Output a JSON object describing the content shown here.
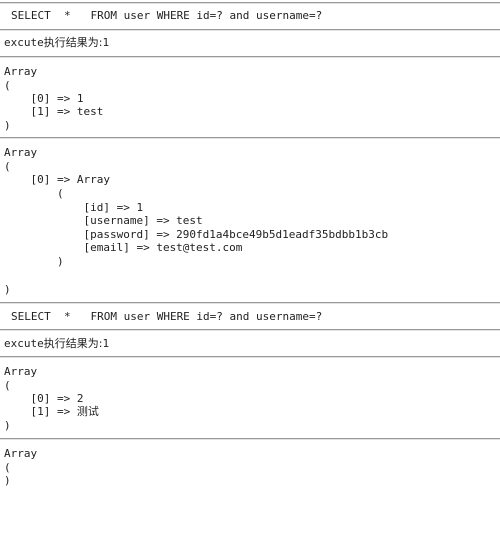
{
  "blocks": [
    {
      "sql": "SELECT  *   FROM user WHERE id=? and username=?",
      "execute_prefix": "excute",
      "execute_label": "执行结果为:",
      "execute_result": "1",
      "params_dump": {
        "lines": [
          "Array",
          "(",
          "    [0] => 1",
          "    [1] => test",
          ")"
        ]
      },
      "result_dump": {
        "lines": [
          "Array",
          "(",
          "    [0] => Array",
          "        (",
          "            [id] => 1",
          "            [username] => test",
          "            [password] => 290fd1a4bce49b5d1eadf35bdbb1b3cb",
          "            [email] => test@test.com",
          "        )",
          "",
          ")"
        ]
      }
    },
    {
      "sql": "SELECT  *   FROM user WHERE id=? and username=?",
      "execute_prefix": "excute",
      "execute_label": "执行结果为:",
      "execute_result": "1",
      "params_dump": {
        "lines": [
          "Array",
          "(",
          "    [0] => 2",
          "    [1] => 测试",
          ")"
        ]
      },
      "result_dump": {
        "lines": [
          "Array",
          "(",
          ")"
        ]
      }
    }
  ]
}
